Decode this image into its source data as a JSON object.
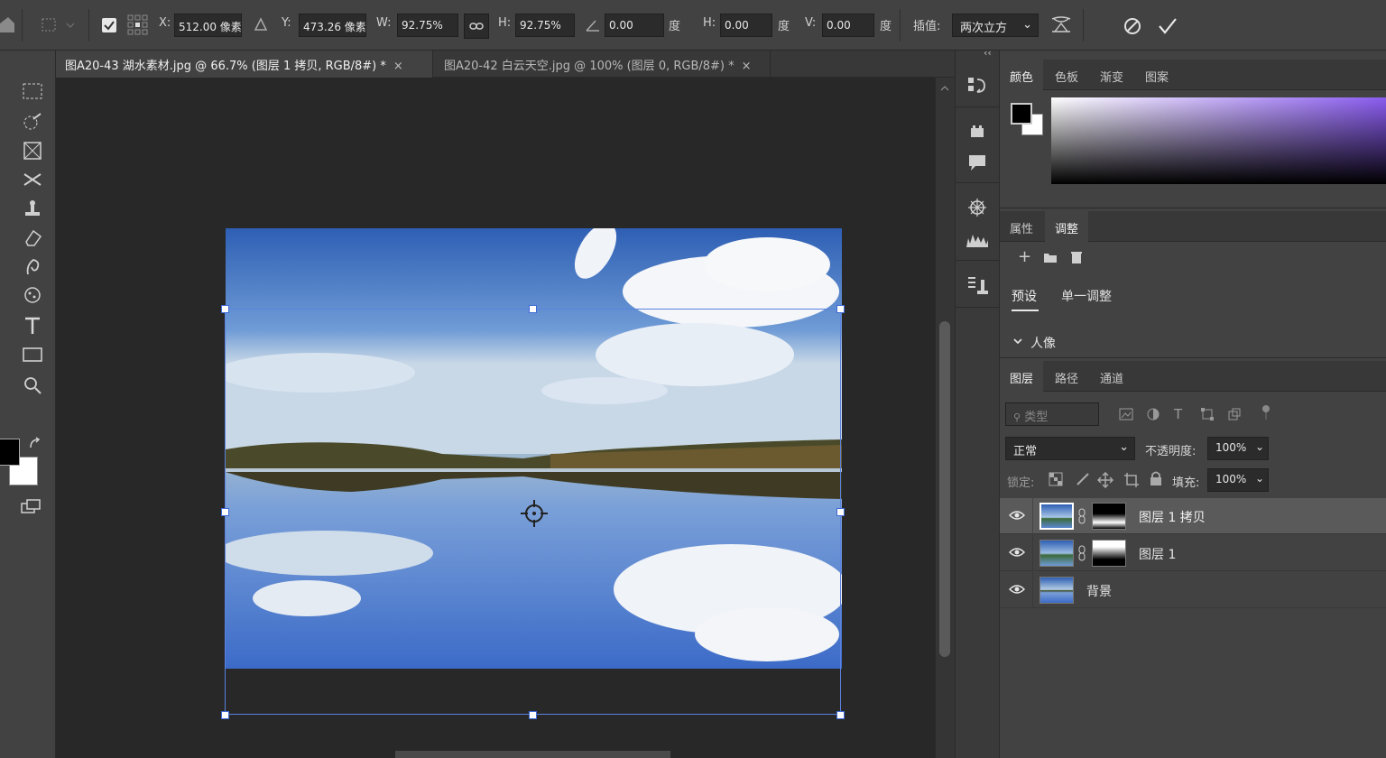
{
  "options_bar": {
    "x_label": "X:",
    "x_value": "512.00 像素",
    "y_label": "Y:",
    "y_value": "473.26 像素",
    "w_label": "W:",
    "w_value": "92.75%",
    "h_label": "H:",
    "h_value": "92.75%",
    "angle_value": "0.00",
    "degree_unit": "度",
    "skew_h_label": "H:",
    "skew_h_value": "0.00",
    "skew_v_label": "V:",
    "skew_v_value": "0.00",
    "interp_label": "插值:",
    "interp_value": "两次立方"
  },
  "tabs": [
    {
      "label": "图A20-43 湖水素材.jpg @ 66.7% (图层 1 拷贝, RGB/8#) *",
      "active": true
    },
    {
      "label": "图A20-42 白云天空.jpg @ 100% (图层 0, RGB/8#) *",
      "active": false
    }
  ],
  "close_glyph": "×",
  "color_panel": {
    "tabs": [
      "颜色",
      "色板",
      "渐变",
      "图案"
    ],
    "spectrum_color": "#8a5cf0"
  },
  "adjust_panel": {
    "tabs": [
      "属性",
      "调整"
    ],
    "sub_tabs": [
      "预设",
      "单一调整"
    ],
    "group_label": "人像"
  },
  "layers_panel": {
    "tabs": [
      "图层",
      "路径",
      "通道"
    ],
    "filter_placeholder": "类型",
    "blend_mode": "正常",
    "opacity_label": "不透明度:",
    "opacity_value": "100%",
    "lock_label": "锁定:",
    "fill_label": "填充:",
    "fill_value": "100%",
    "layers": [
      {
        "name": "图层 1 拷贝",
        "has_mask": true,
        "selected": true
      },
      {
        "name": "图层 1",
        "has_mask": true,
        "selected": false
      },
      {
        "name": "背景",
        "has_mask": false,
        "selected": false
      }
    ]
  },
  "colors": {
    "foreground": "#000000",
    "background": "#ffffff",
    "accent_handles": "#3d6ad6"
  },
  "icons": {
    "home": "home-icon",
    "cancel": "cancel-icon",
    "commit": "checkmark-icon",
    "warp": "warp-icon",
    "link": "link-icon"
  }
}
